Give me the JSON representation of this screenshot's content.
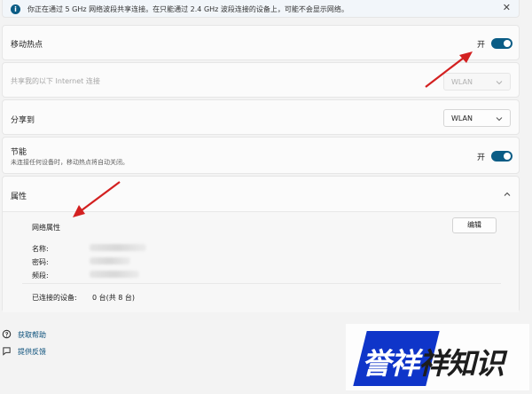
{
  "banner": {
    "text": "你正在通过 5 GHz 网络波段共享连接。在只能通过 2.4 GHz 波段连接的设备上，可能不会显示网络。"
  },
  "hotspot": {
    "label": "移动热点",
    "toggle_label": "开",
    "on": true
  },
  "share_from": {
    "label": "共享我的以下 Internet 连接",
    "value": "WLAN"
  },
  "share_to": {
    "label": "分享到",
    "value": "WLAN"
  },
  "power_saving": {
    "label": "节能",
    "description": "未连接任何设备时，移动热点将自动关闭。",
    "toggle_label": "开",
    "on": true
  },
  "properties": {
    "header": "属性",
    "network_props_label": "网络属性",
    "edit_button": "编辑",
    "fields": [
      {
        "label": "名称:"
      },
      {
        "label": "密码:"
      },
      {
        "label": "频段:"
      }
    ],
    "connected_label": "已连接的设备:",
    "connected_value": "0 台(共 8 台)"
  },
  "links": {
    "help": "获取帮助",
    "feedback": "提供反馈"
  },
  "watermark": {
    "text": "誉祥祥知识"
  },
  "colors": {
    "accent": "#0a5c85",
    "arrow": "#d32020",
    "watermark_bg": "#0f35c9"
  }
}
